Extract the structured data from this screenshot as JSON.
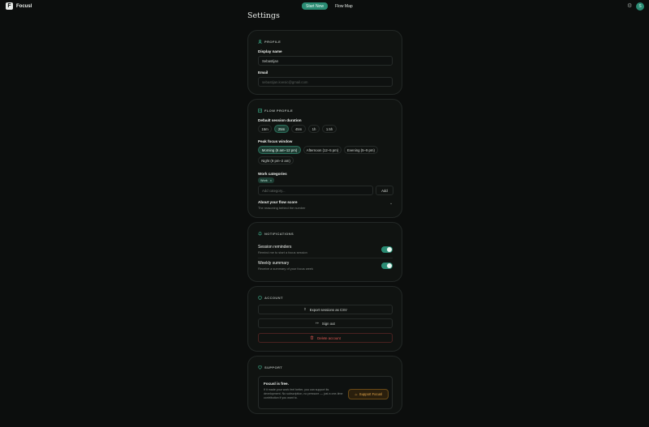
{
  "app": {
    "name": "Focusl",
    "logo_letter": "F"
  },
  "nav": {
    "start_now": "Start Now",
    "flow_map": "Flow Map"
  },
  "header": {
    "avatar_initial": "S"
  },
  "page": {
    "title": "Settings"
  },
  "profile": {
    "heading": "PROFILE",
    "display_name_label": "Display name",
    "display_name_value": "Sebastijan",
    "email_label": "Email",
    "email_value": "sebastijan.kvesic@gmail.com"
  },
  "flow_profile": {
    "heading": "FLOW PROFILE",
    "duration_label": "Default session duration",
    "durations": [
      "15m",
      "25m",
      "45m",
      "1h",
      "1.5h"
    ],
    "duration_selected": "25m",
    "peak_label": "Peak focus window",
    "peak_options": [
      "Morning (6 am–12 pm)",
      "Afternoon (12–5 pm)",
      "Evening (5–9 pm)",
      "Night (9 pm–2 am)"
    ],
    "peak_selected": "Morning (6 am–12 pm)",
    "categories_label": "Work categories",
    "categories": [
      "Work"
    ],
    "category_remove_glyph": "×",
    "add_placeholder": "Add category...",
    "add_button": "Add",
    "flow_score_title": "About your flow score",
    "flow_score_sub": "The reasoning behind the number",
    "chevron_glyph": "⌄"
  },
  "notifications": {
    "heading": "NOTIFICATIONS",
    "reminders_title": "Session reminders",
    "reminders_sub": "Remind me to start a focus session",
    "reminders_on": true,
    "weekly_title": "Weekly summary",
    "weekly_sub": "Receive a summary of your focus week",
    "weekly_on": true
  },
  "account": {
    "heading": "ACCOUNT",
    "export": "Export sessions as CSV",
    "sign_out": "Sign out",
    "delete": "Delete account"
  },
  "support": {
    "heading": "SUPPORT",
    "title": "Focusl is free.",
    "text": "If it made your work feel better, you can support its development. No subscription, no pressure — just a one-time contribution if you want to.",
    "button": "Support Focusl"
  },
  "colors": {
    "accent": "#2a8b73",
    "danger": "#e05a55",
    "support": "#e7a84a",
    "background": "#0c0e0d"
  },
  "icons": [
    "user-icon",
    "bars-icon",
    "bell-icon",
    "shield-icon",
    "heart-icon",
    "upload-icon",
    "sign-out-icon",
    "trash-icon",
    "coffee-icon",
    "gear-icon"
  ]
}
